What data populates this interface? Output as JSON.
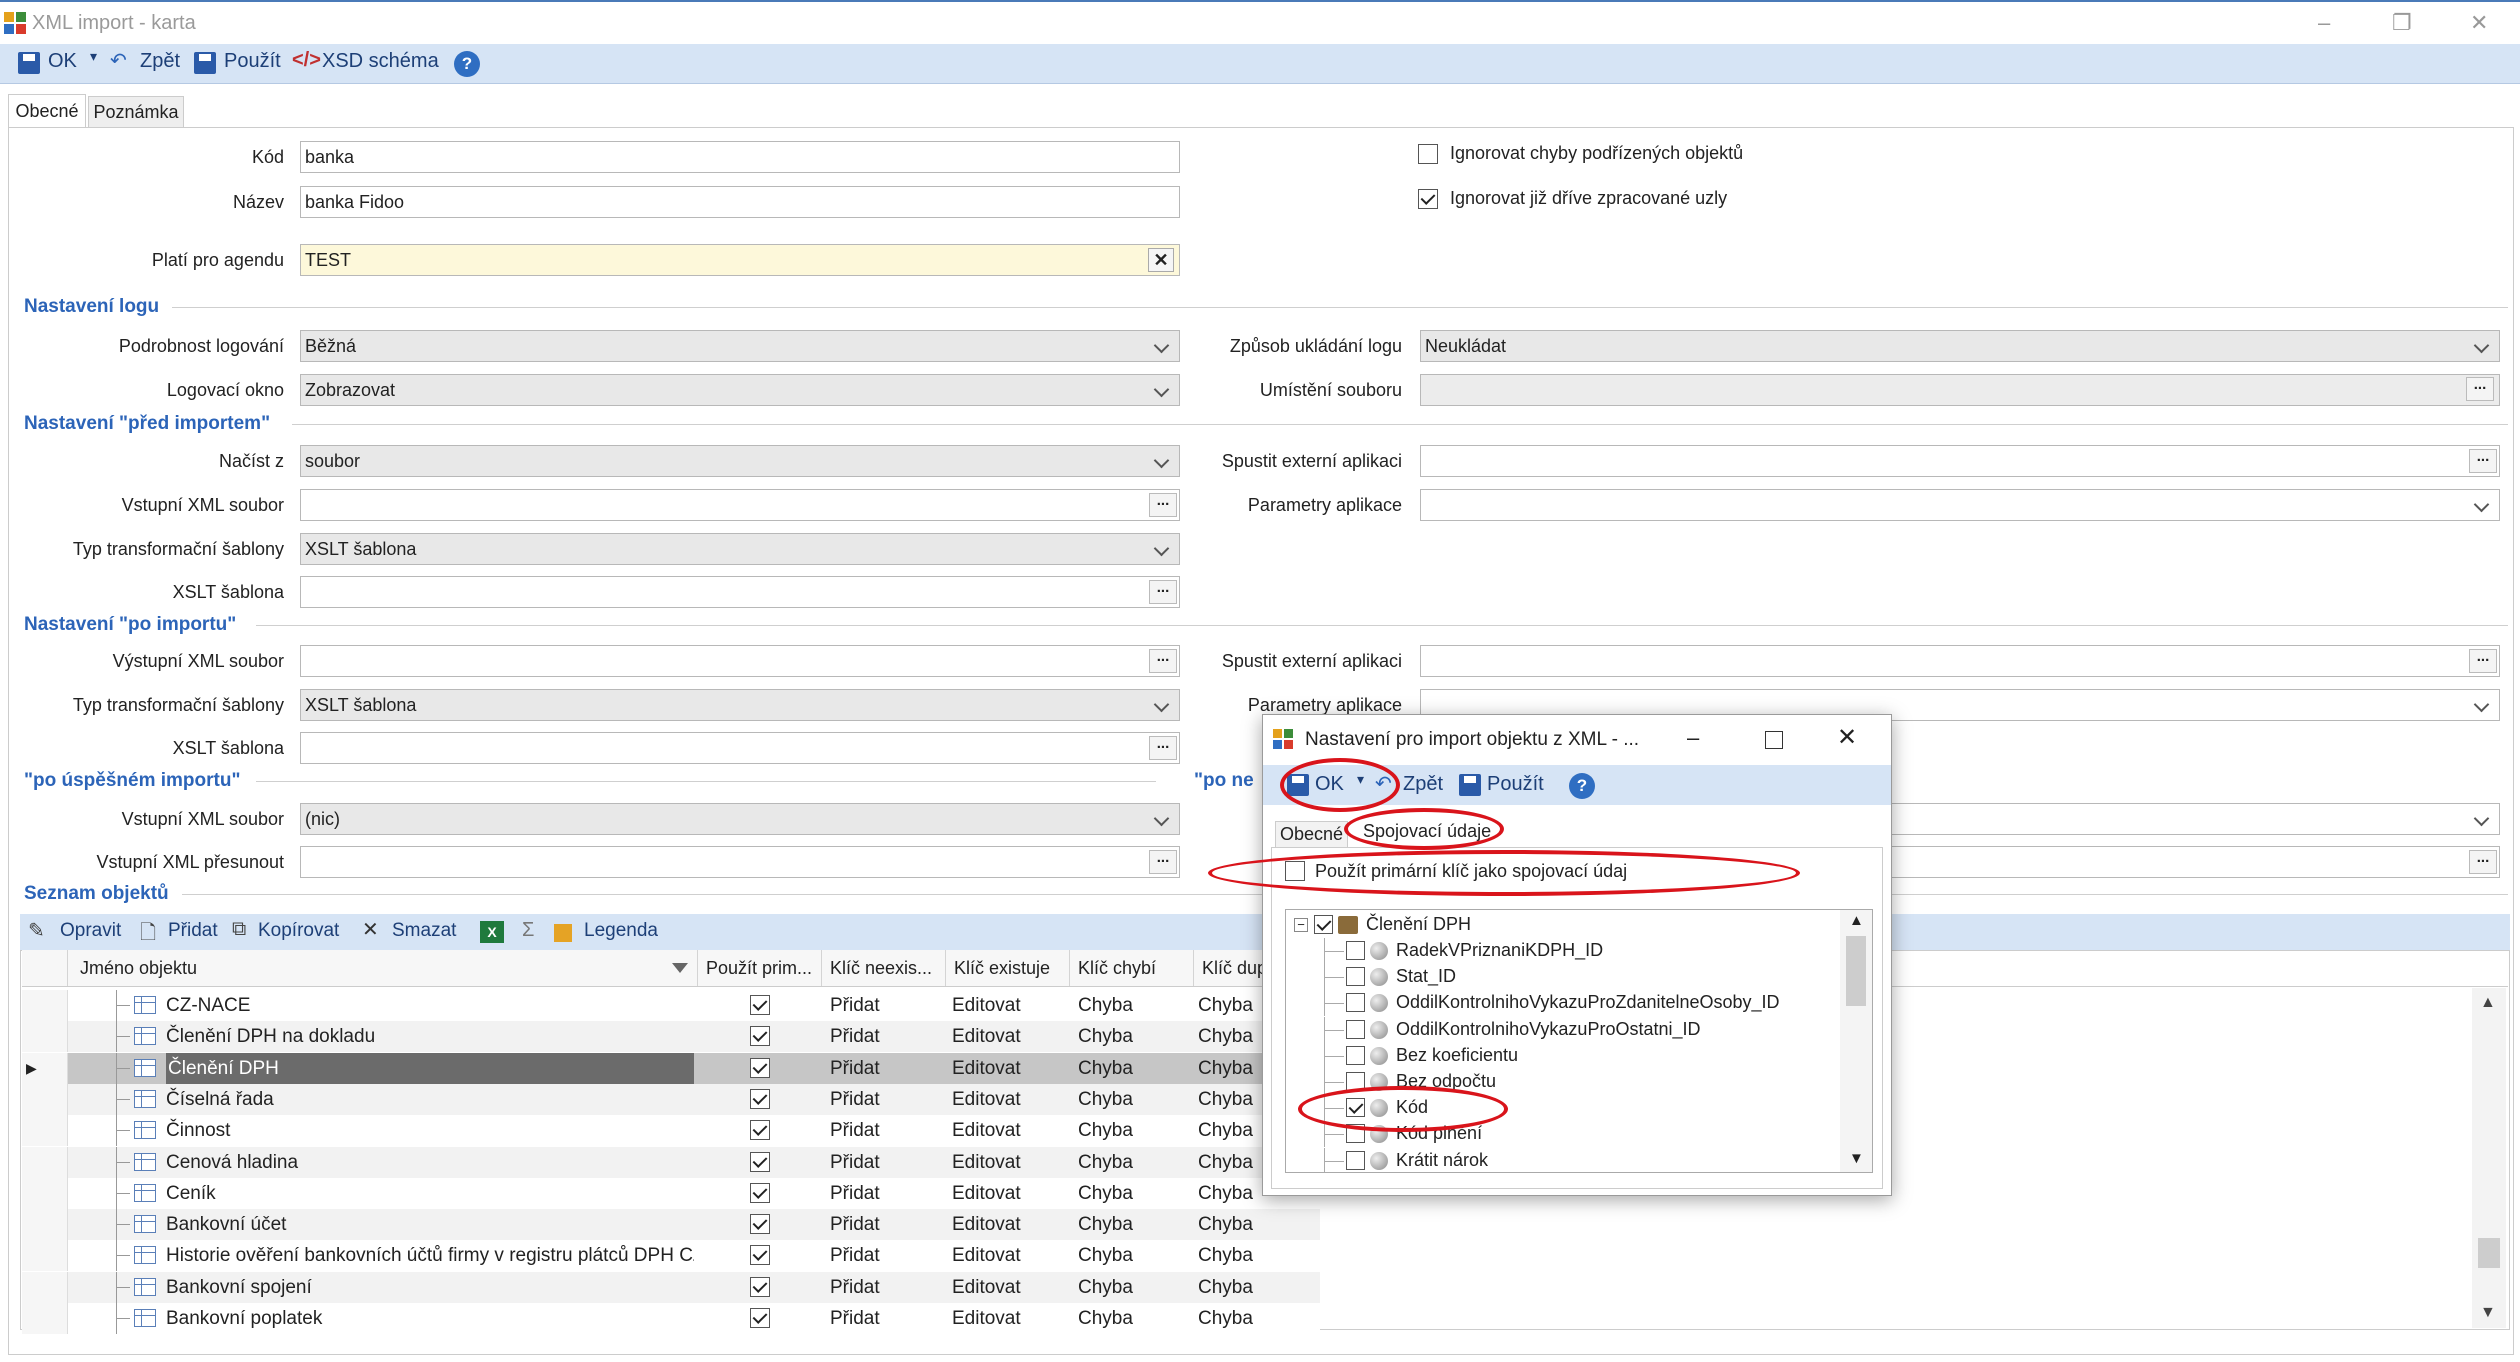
{
  "window": {
    "title": "XML import - karta",
    "min": "–",
    "max": "❐",
    "close": "✕"
  },
  "toolbar": {
    "ok": "OK",
    "back": "Zpět",
    "apply": "Použít",
    "xsd": "XSD schéma",
    "help": "?"
  },
  "tabs": [
    "Obecné",
    "Poznámka"
  ],
  "form": {
    "kod_label": "Kód",
    "kod": "banka",
    "nazev_label": "Název",
    "nazev": "banka Fidoo",
    "agenda_label": "Platí pro agendu",
    "agenda": "TEST",
    "ign1": "Ignorovat chyby podřízených objektů",
    "ign2": "Ignorovat již dříve zpracované uzly"
  },
  "log": {
    "title": "Nastavení logu",
    "podrobnost_label": "Podrobnost logování",
    "podrobnost": "Běžná",
    "okno_label": "Logovací okno",
    "okno": "Zobrazovat",
    "zpusob_label": "Způsob ukládání logu",
    "zpusob": "Neukládat",
    "umisteni_label": "Umístění souboru",
    "umisteni": ""
  },
  "pre": {
    "title": "Nastavení \"před importem\"",
    "nacist_label": "Načíst z",
    "nacist": "soubor",
    "vstup_label": "Vstupní XML soubor",
    "typ_label": "Typ transformační šablony",
    "typ": "XSLT šablona",
    "xslt_label": "XSLT šablona",
    "spustit_label": "Spustit externí aplikaci",
    "param_label": "Parametry aplikace"
  },
  "post": {
    "title": "Nastavení \"po importu\"",
    "vystup_label": "Výstupní XML soubor",
    "typ_label": "Typ transformační šablony",
    "typ": "XSLT šablona",
    "xslt_label": "XSLT šablona",
    "spustit_label": "Spustit externí aplikaci",
    "param_label": "Parametry aplikace"
  },
  "success": {
    "title": "\"po úspěšném importu\"",
    "vstup_label": "Vstupní XML soubor",
    "vstup": "(nic)",
    "presun_label": "Vstupní XML přesunout",
    "right_title": "\"po ne"
  },
  "objects": {
    "title": "Seznam objektů",
    "edit": "Opravit",
    "add": "Přidat",
    "copy": "Kopírovat",
    "del": "Smazat",
    "sigma": "Σ",
    "legend": "Legenda"
  },
  "grid": {
    "headers": [
      "Jméno objektu",
      "Použít prim...",
      "Klíč neexis...",
      "Klíč existuje",
      "Klíč chybí",
      "Klíč dup"
    ],
    "rows": [
      {
        "name": "CZ-NACE",
        "a": "Přidat",
        "b": "Editovat",
        "c": "Chyba",
        "d": "Chyba"
      },
      {
        "name": "Členění DPH na dokladu",
        "a": "Přidat",
        "b": "Editovat",
        "c": "Chyba",
        "d": "Chyba"
      },
      {
        "name": "Členění DPH",
        "a": "Přidat",
        "b": "Editovat",
        "c": "Chyba",
        "d": "Chyba"
      },
      {
        "name": "Číselná řada",
        "a": "Přidat",
        "b": "Editovat",
        "c": "Chyba",
        "d": "Chyba"
      },
      {
        "name": "Činnost",
        "a": "Přidat",
        "b": "Editovat",
        "c": "Chyba",
        "d": "Chyba"
      },
      {
        "name": "Cenová hladina",
        "a": "Přidat",
        "b": "Editovat",
        "c": "Chyba",
        "d": "Chyba"
      },
      {
        "name": "Ceník",
        "a": "Přidat",
        "b": "Editovat",
        "c": "Chyba",
        "d": "Chyba"
      },
      {
        "name": "Bankovní účet",
        "a": "Přidat",
        "b": "Editovat",
        "c": "Chyba",
        "d": "Chyba"
      },
      {
        "name": "Historie ověření bankovních účtů firmy v registru plátců DPH CZ",
        "a": "Přidat",
        "b": "Editovat",
        "c": "Chyba",
        "d": "Chyba"
      },
      {
        "name": "Bankovní spojení",
        "a": "Přidat",
        "b": "Editovat",
        "c": "Chyba",
        "d": "Chyba"
      },
      {
        "name": "Bankovní poplatek",
        "a": "Přidat",
        "b": "Editovat",
        "c": "Chyba",
        "d": "Chyba"
      }
    ]
  },
  "dialog": {
    "title": "Nastavení pro import objektu z XML - ...",
    "ok": "OK",
    "back": "Zpět",
    "apply": "Použít",
    "tab1": "Obecné",
    "tab2": "Spojovací údaje",
    "usepk": "Použít primární klíč jako spojovací údaj",
    "tree_root": "Členění DPH",
    "tree": [
      "RadekVPriznaniKDPH_ID",
      "Stat_ID",
      "OddilKontrolnihoVykazuProZdanitelneOsoby_ID",
      "OddilKontrolnihoVykazuProOstatni_ID",
      "Bez koeficientu",
      "Bez odpočtu",
      "Kód",
      "Kód plnění",
      "Krátit nárok"
    ]
  }
}
